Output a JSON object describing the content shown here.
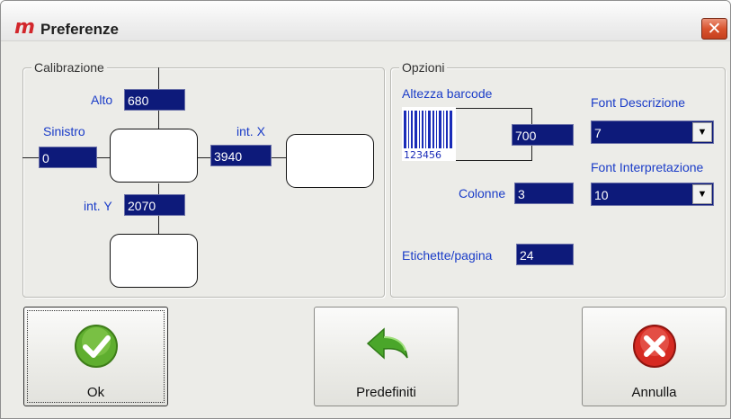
{
  "window": {
    "title": "Preferenze",
    "app_icon": "m",
    "close_label": "✕"
  },
  "calibrazione": {
    "title": "Calibrazione",
    "alto": {
      "label": "Alto",
      "value": "680"
    },
    "sinistro": {
      "label": "Sinistro",
      "value": "0"
    },
    "int_x": {
      "label": "int. X",
      "value": "3940"
    },
    "int_y": {
      "label": "int. Y",
      "value": "2070"
    }
  },
  "opzioni": {
    "title": "Opzioni",
    "altezza": {
      "label": "Altezza barcode",
      "value": "700",
      "barcode_text": "123456"
    },
    "colonne": {
      "label": "Colonne",
      "value": "3"
    },
    "etichette": {
      "label": "Etichette/pagina",
      "value": "24"
    },
    "font_descrizione": {
      "label": "Font Descrizione",
      "value": "7"
    },
    "font_interpretazione": {
      "label": "Font Interpretazione",
      "value": "10"
    }
  },
  "buttons": {
    "ok": {
      "label": "Ok",
      "icon": "check-icon"
    },
    "predefiniti": {
      "label": "Predefiniti",
      "icon": "undo-arrow-icon"
    },
    "annulla": {
      "label": "Annulla",
      "icon": "cancel-icon"
    }
  }
}
